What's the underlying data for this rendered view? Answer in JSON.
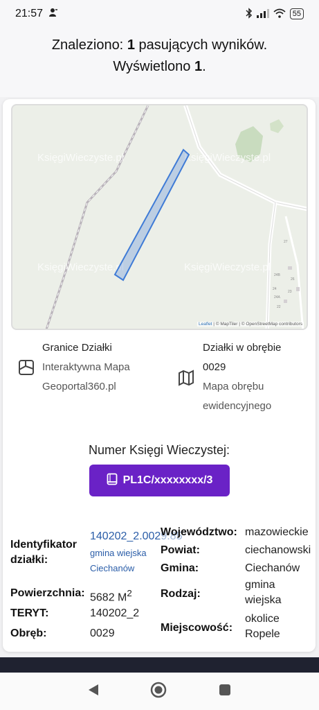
{
  "status_bar": {
    "time": "21:57",
    "battery": "55"
  },
  "result_header": {
    "line1_prefix": "Znaleziono: ",
    "line1_count": "1",
    "line1_suffix": " pasujących wyników.",
    "line2_prefix": "Wyświetlono ",
    "line2_count": "1",
    "line2_suffix": "."
  },
  "map": {
    "watermark": "KsięgiWieczyste.pl",
    "house_numbers": [
      "27",
      "24B",
      "26",
      "24",
      "24A",
      "23",
      "22"
    ],
    "attribution_leaflet": "Leaflet",
    "attribution_rest": " | © MapTiler | © OpenStreetMap contributors",
    "parcel_color": "#3f7bd6"
  },
  "info": {
    "left_title": "Granice Działki",
    "left_link_line1": "Interaktywna Mapa",
    "left_link_line2": "Geoportal360.pl",
    "right_title_line1": "Działki w obrębie",
    "right_title_line2": "0029",
    "right_link_line1": "Mapa obrębu",
    "right_link_line2": "ewidencyjnego",
    "left_icon": "map-boundary-icon",
    "right_icon": "folded-map-icon"
  },
  "kw": {
    "label": "Numer Księgi Wieczystej:",
    "button_label": "PL1C/xxxxxxxx/3",
    "button_icon": "book-icon",
    "button_color": "#6a22c6"
  },
  "details": {
    "identyfikator_label_line1": "Identyfikator",
    "identyfikator_label_line2": "działki:",
    "identyfikator_value": "140202_2.0029.85",
    "identyfikator_sub_line1": "gmina wiejska",
    "identyfikator_sub_line2": "Ciechanów",
    "powierzchnia_label": "Powierzchnia:",
    "powierzchnia_value": "5682 M",
    "powierzchnia_sup": "2",
    "teryt_label": "TERYT:",
    "teryt_value": "140202_2",
    "obreb_label": "Obręb:",
    "obreb_value": "0029",
    "wojewodztwo_label": "Województwo:",
    "wojewodztwo_value": "mazowieckie",
    "powiat_label": "Powiat:",
    "powiat_value": "ciechanowski",
    "gmina_label": "Gmina:",
    "gmina_value": "Ciechanów",
    "rodzaj_label": "Rodzaj:",
    "rodzaj_value_line1": "gmina",
    "rodzaj_value_line2": "wiejska",
    "miejscowosc_label": "Miejscowość:",
    "miejscowosc_value_line1": "okolice",
    "miejscowosc_value_line2": "Ropele"
  },
  "nav_bar": {
    "back_icon": "back-triangle-icon",
    "home_icon": "home-circle-icon",
    "recents_icon": "recents-square-icon"
  }
}
